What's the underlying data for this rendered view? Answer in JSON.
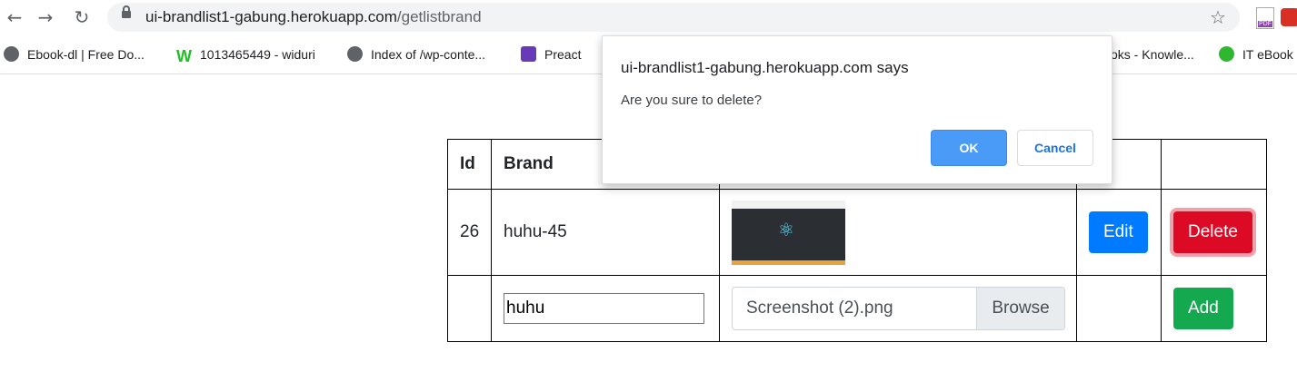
{
  "browser": {
    "url_host": "ui-brandlist1-gabung.herokuapp.com",
    "url_path": "/getlistbrand",
    "back_icon": "arrow-left-icon",
    "forward_icon": "arrow-right-icon",
    "reload_icon": "reload-icon",
    "star_icon": "star-icon"
  },
  "bookmarks": [
    {
      "label": "Ebook-dl | Free Do...",
      "icon": "globe-icon"
    },
    {
      "label": "1013465449 - widuri",
      "icon": "w-logo-icon"
    },
    {
      "label": "Index of /wp-conte...",
      "icon": "globe-icon"
    },
    {
      "label": "Preact",
      "icon": "preact-icon"
    },
    {
      "label": "oks - Knowle...",
      "icon": ""
    },
    {
      "label": "IT eBook",
      "icon": "green-dot-icon"
    }
  ],
  "table": {
    "headers": [
      "Id",
      "Brand",
      "",
      "",
      ""
    ],
    "rows": [
      {
        "id": "26",
        "brand": "huhu-45",
        "edit_label": "Edit",
        "delete_label": "Delete"
      }
    ],
    "form": {
      "brand_value": "huhu",
      "file_name": "Screenshot (2).png",
      "browse_label": "Browse",
      "add_label": "Add"
    }
  },
  "dialog": {
    "title": "ui-brandlist1-gabung.herokuapp.com says",
    "message": "Are you sure to delete?",
    "ok_label": "OK",
    "cancel_label": "Cancel"
  },
  "colors": {
    "edit": "#007bff",
    "delete": "#dc0a24",
    "add": "#14a94f",
    "ok": "#4a9af7"
  }
}
